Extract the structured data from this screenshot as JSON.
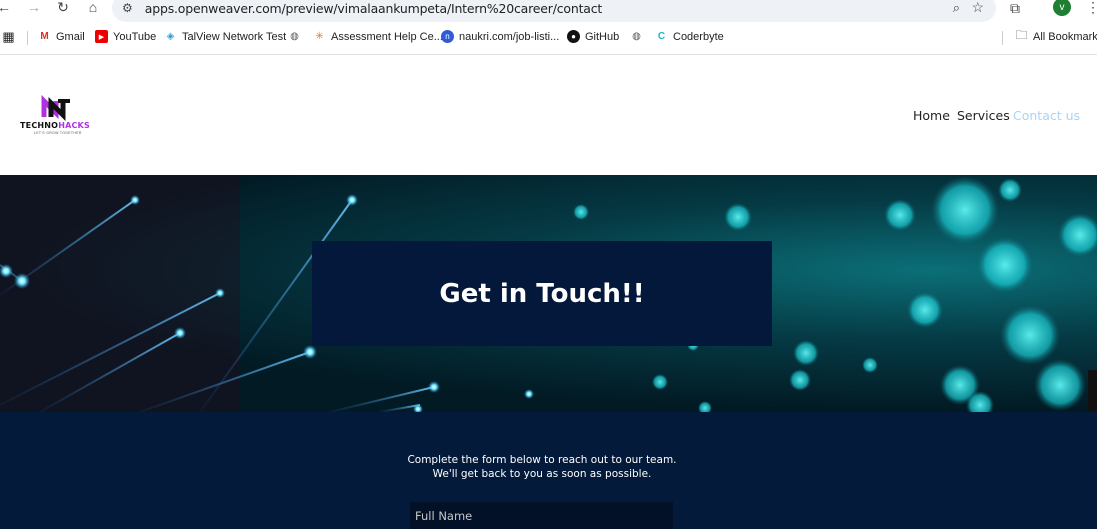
{
  "browser": {
    "url": "apps.openweaver.com/preview/vimalaankumpeta/Intern%20career/contact",
    "profile_initial": "v",
    "bookmarks": [
      {
        "label": "Gmail",
        "icon": "gmail-icon"
      },
      {
        "label": "YouTube",
        "icon": "youtube-icon"
      },
      {
        "label": "TalView Network Test",
        "icon": "talview-icon"
      },
      {
        "label": "",
        "icon": "globe-icon"
      },
      {
        "label": "Assessment Help Ce...",
        "icon": "assessment-icon"
      },
      {
        "label": "naukri.com/job-listi...",
        "icon": "naukri-icon"
      },
      {
        "label": "GitHub",
        "icon": "github-icon"
      },
      {
        "label": "",
        "icon": "globe-icon"
      },
      {
        "label": "Coderbyte",
        "icon": "coderbyte-icon"
      }
    ],
    "all_bookmarks": "All Bookmarks"
  },
  "site": {
    "logo": {
      "text_main": "TECHNO",
      "text_highlight": "HACKS",
      "tagline": "LET'S GROW TOGETHER"
    },
    "nav": {
      "home": "Home",
      "services": "Services",
      "contact": "Contact us"
    },
    "hero_title": "Get in Touch!!",
    "form": {
      "intro": "Complete the form below to reach out to our team. We'll get back to you as soon as possible.",
      "full_name_placeholder": "Full Name"
    }
  },
  "colors": {
    "accent": "#b030e0",
    "form_bg": "#041a3a",
    "hero_box": "#03183a",
    "nav_active": "#a9d4f5"
  }
}
